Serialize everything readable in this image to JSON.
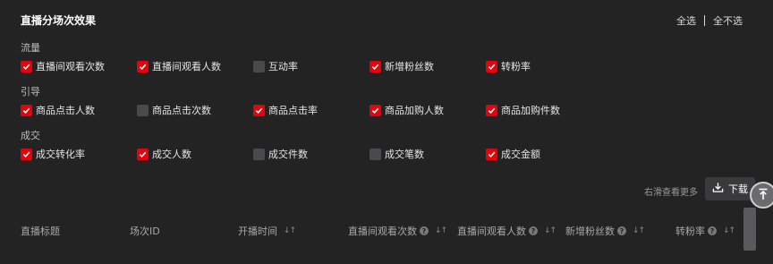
{
  "title": "直播分场次效果",
  "select_all": "全选",
  "deselect_all": "全不选",
  "groups": [
    {
      "label": "流量",
      "items": [
        {
          "label": "直播间观看次数",
          "checked": true
        },
        {
          "label": "直播间观看人数",
          "checked": true
        },
        {
          "label": "互动率",
          "checked": false
        },
        {
          "label": "新增粉丝数",
          "checked": true
        },
        {
          "label": "转粉率",
          "checked": true
        }
      ]
    },
    {
      "label": "引导",
      "items": [
        {
          "label": "商品点击人数",
          "checked": true
        },
        {
          "label": "商品点击次数",
          "checked": false
        },
        {
          "label": "商品点击率",
          "checked": true
        },
        {
          "label": "商品加购人数",
          "checked": true
        },
        {
          "label": "商品加购件数",
          "checked": true
        }
      ]
    },
    {
      "label": "成交",
      "items": [
        {
          "label": "成交转化率",
          "checked": true
        },
        {
          "label": "成交人数",
          "checked": true
        },
        {
          "label": "成交件数",
          "checked": false
        },
        {
          "label": "成交笔数",
          "checked": false
        },
        {
          "label": "成交金额",
          "checked": true
        }
      ]
    }
  ],
  "scroll_hint": "右滑查看更多",
  "download_label": "下载",
  "table": {
    "columns": [
      {
        "label": "直播标题",
        "help": false,
        "sort": false
      },
      {
        "label": "场次ID",
        "help": false,
        "sort": false
      },
      {
        "label": "开播时间",
        "help": false,
        "sort": true
      },
      {
        "label": "直播间观看次数",
        "help": true,
        "sort": true
      },
      {
        "label": "直播间观看人数",
        "help": true,
        "sort": true
      },
      {
        "label": "新增粉丝数",
        "help": true,
        "sort": true
      },
      {
        "label": "转粉率",
        "help": true,
        "sort": true
      }
    ]
  },
  "colors": {
    "background": "#232324",
    "checked": "#e8000b",
    "unchecked": "#4a4a4c"
  }
}
